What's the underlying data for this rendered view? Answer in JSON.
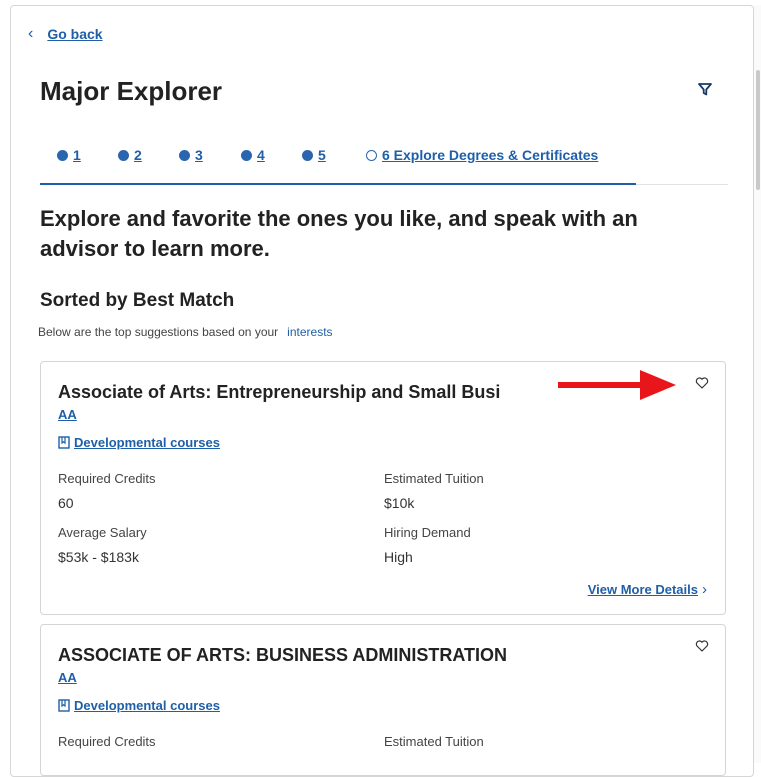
{
  "nav": {
    "back_label": "Go back"
  },
  "page": {
    "title": "Major Explorer"
  },
  "steps": [
    {
      "label": "1",
      "done": true
    },
    {
      "label": "2",
      "done": true
    },
    {
      "label": "3",
      "done": true
    },
    {
      "label": "4",
      "done": true
    },
    {
      "label": "5",
      "done": true
    },
    {
      "label": "6 Explore Degrees & Certificates",
      "done": false
    }
  ],
  "intro": "Explore and favorite the ones you like, and speak with an advisor to learn more.",
  "section": {
    "heading": "Sorted by Best Match",
    "subtext": "Below are the top suggestions based on your",
    "subtext_link": "interests"
  },
  "cards": [
    {
      "title": "Associate of Arts: Entrepreneurship and Small Busi",
      "degree": "AA",
      "dev_courses": "Developmental courses",
      "required_credits_label": "Required Credits",
      "required_credits": "60",
      "tuition_label": "Estimated Tuition",
      "tuition": "$10k",
      "salary_label": "Average Salary",
      "salary": "$53k - $183k",
      "demand_label": "Hiring Demand",
      "demand": "High",
      "more_label": "View More Details"
    },
    {
      "title": "ASSOCIATE OF ARTS: BUSINESS ADMINISTRATION",
      "degree": "AA",
      "dev_courses": "Developmental courses",
      "required_credits_label": "Required Credits",
      "tuition_label": "Estimated Tuition"
    }
  ],
  "colors": {
    "link": "#1f5fa8",
    "annotation_arrow": "#e8161b"
  }
}
